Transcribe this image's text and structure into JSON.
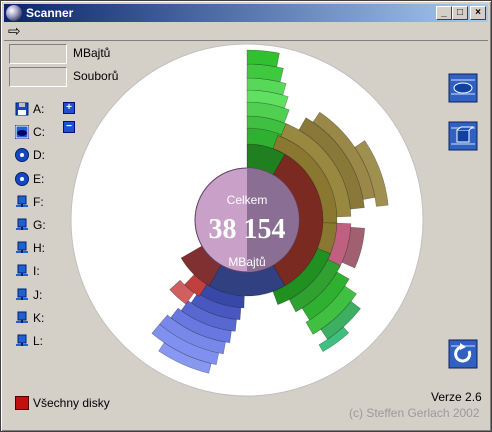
{
  "window": {
    "title": "Scanner"
  },
  "title_buttons": {
    "minimize": "_",
    "maximize": "□",
    "close": "×"
  },
  "stats": {
    "size_unit": "MBajtů",
    "files_label": "Souborů"
  },
  "drives": [
    {
      "letter": "A:",
      "icon": "floppy-icon"
    },
    {
      "letter": "C:",
      "icon": "harddisk-icon"
    },
    {
      "letter": "D:",
      "icon": "cdrom-icon"
    },
    {
      "letter": "E:",
      "icon": "cdrom-icon"
    },
    {
      "letter": "F:",
      "icon": "network-drive-icon"
    },
    {
      "letter": "G:",
      "icon": "network-drive-icon"
    },
    {
      "letter": "H:",
      "icon": "network-drive-icon"
    },
    {
      "letter": "I:",
      "icon": "network-drive-icon"
    },
    {
      "letter": "J:",
      "icon": "network-drive-icon"
    },
    {
      "letter": "K:",
      "icon": "network-drive-icon"
    },
    {
      "letter": "L:",
      "icon": "network-drive-icon"
    }
  ],
  "zoom": {
    "plus": "+",
    "minus": "−"
  },
  "center": {
    "top_label": "Celkem",
    "total": "38 154",
    "unit": "MBajtů"
  },
  "all_drives_label": "Všechny disky",
  "version": "Verze 2.6",
  "copyright": "(c) Steffen Gerlach 2002",
  "colors": {
    "titlebar_start": "#0a246a",
    "titlebar_end": "#a6caf0",
    "center_disc": "#c8a0c8",
    "accent": "#2050d0"
  }
}
